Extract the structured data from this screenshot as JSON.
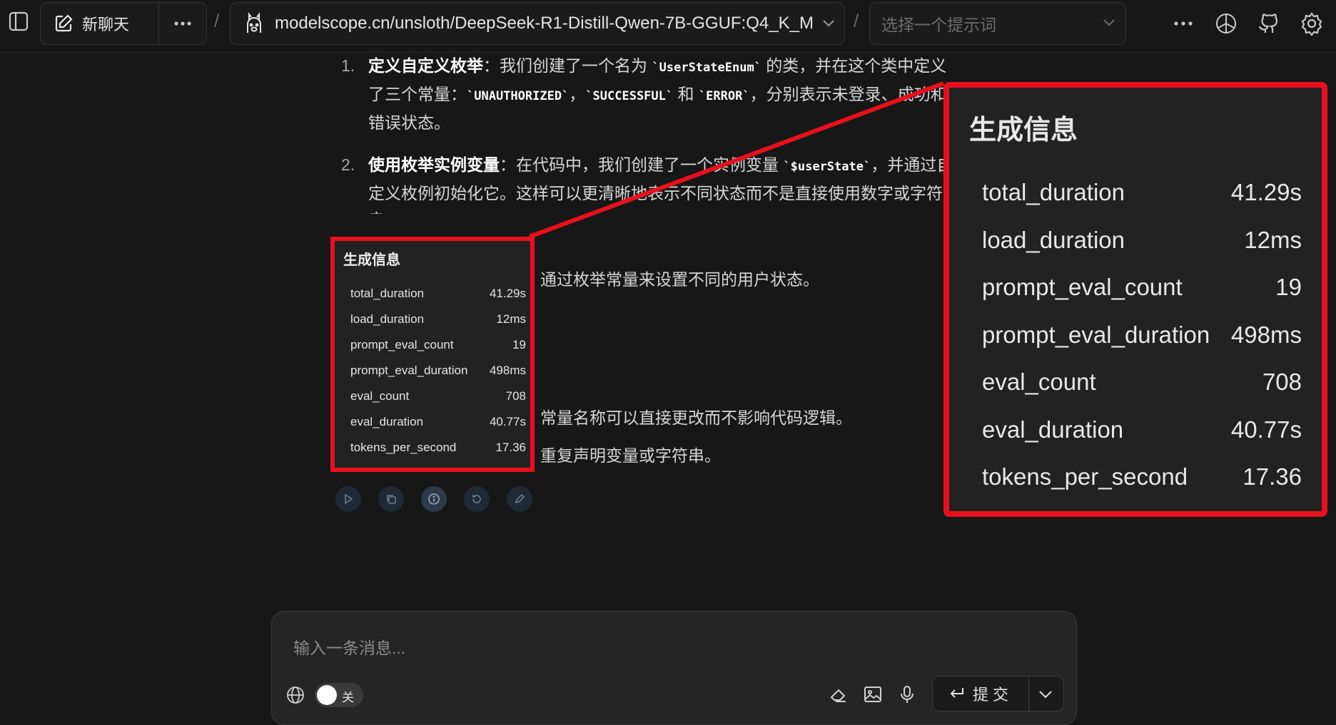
{
  "header": {
    "new_chat_label": "新聊天",
    "model_name": "modelscope.cn/unsloth/DeepSeek-R1-Distill-Qwen-7B-GGUF:Q4_K_M",
    "prompt_placeholder": "选择一个提示词",
    "separator": "/"
  },
  "message": {
    "items": [
      {
        "num": "1.",
        "bold": "定义自定义枚举",
        "t1": "：我们创建了一个名为 ",
        "c1": "`UserStateEnum`",
        "t2": " 的类，并在这个类中定义了三个常量：",
        "c2": "`UNAUTHORIZED`",
        "t3": "，",
        "c3": "`SUCCESSFUL`",
        "t4": " 和 ",
        "c4": "`ERROR`",
        "t5": "，分别表示未登录、成功和错误状态。"
      },
      {
        "num": "2.",
        "bold": "使用枚举实例变量",
        "t1": "：在代码中，我们创建了一个实例变量 ",
        "c1": "`$userState`",
        "t2": "，并通过自定义枚例初始化它。这样可以更清晰地表示不同状态而不是直接使用数字或字符串。"
      }
    ],
    "line_a": "通过枚举常量来设置不同的用户状态。",
    "line_b": "常量名称可以直接更改而不影响代码逻辑。",
    "line_c": "重复声明变量或字符串。"
  },
  "generation_info": {
    "title": "生成信息",
    "rows": [
      {
        "key": "total_duration",
        "value": "41.29s"
      },
      {
        "key": "load_duration",
        "value": "12ms"
      },
      {
        "key": "prompt_eval_count",
        "value": "19"
      },
      {
        "key": "prompt_eval_duration",
        "value": "498ms"
      },
      {
        "key": "eval_count",
        "value": "708"
      },
      {
        "key": "eval_duration",
        "value": "40.77s"
      },
      {
        "key": "tokens_per_second",
        "value": "17.36"
      }
    ]
  },
  "composer": {
    "placeholder": "输入一条消息...",
    "toggle_label": "关",
    "submit_label": "提交"
  },
  "colors": {
    "highlight": "#e8101e",
    "background": "#171717"
  }
}
